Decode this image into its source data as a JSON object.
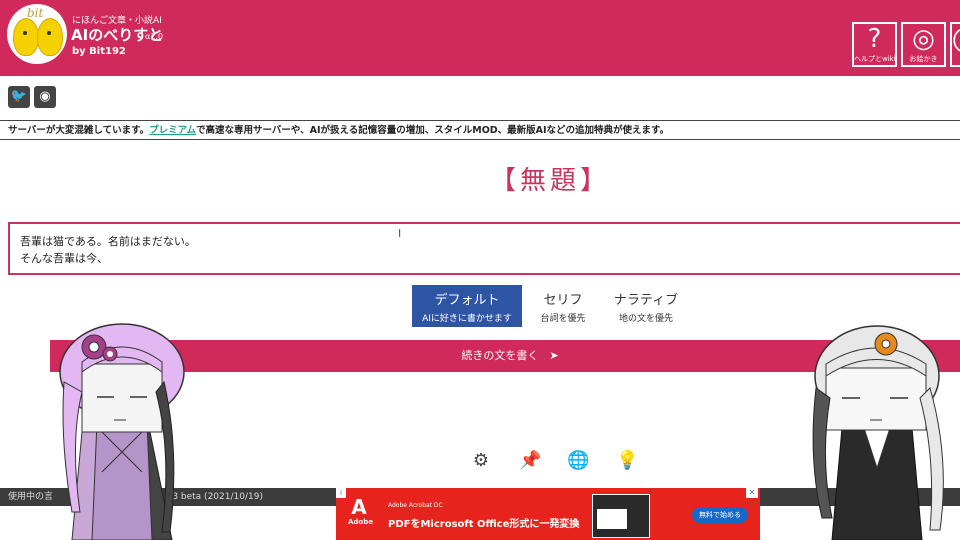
{
  "header": {
    "logo_text": "bit",
    "tagline": "にほんご文章・小説AI",
    "title": "AIのべりすと",
    "version": "α2.0",
    "byline": "by Bit192",
    "help_label": "ヘルプとwiki",
    "ask_label": "お絵かき"
  },
  "social": {
    "twitter_icon": "twitter-icon",
    "discord_icon": "discord-icon"
  },
  "notice": {
    "before": "サーバーが大変混雑しています。",
    "link": "プレミアム",
    "after": "で高速な専用サーバーや、AIが扱える記憶容量の増加、スタイルMOD、最新版AIなどの追加特典が使えます。"
  },
  "document": {
    "title": "【無題】",
    "line1": "吾輩は猫である。名前はまだない。",
    "line2": "そんな吾輩は今、"
  },
  "modes": [
    {
      "label": "デフォルト",
      "sub": "AIに好きに書かせます"
    },
    {
      "label": "セリフ",
      "sub": "台詞を優先"
    },
    {
      "label": "ナラティブ",
      "sub": "地の文を優先"
    }
  ],
  "continue_label": "続きの文を書く　➤",
  "status": {
    "left": "使用中の言",
    "right": "さま6.13 beta (2021/10/19)"
  },
  "ad": {
    "logo": "Adobe",
    "brand": "Adobe Acrobat DC",
    "headline": "PDFをMicrosoft Office形式に一発変換",
    "cta": "無料で始める"
  },
  "colors": {
    "brand": "#cf2a5b",
    "mode_active": "#2e55a3",
    "notice_link": "#1f9e8d"
  }
}
